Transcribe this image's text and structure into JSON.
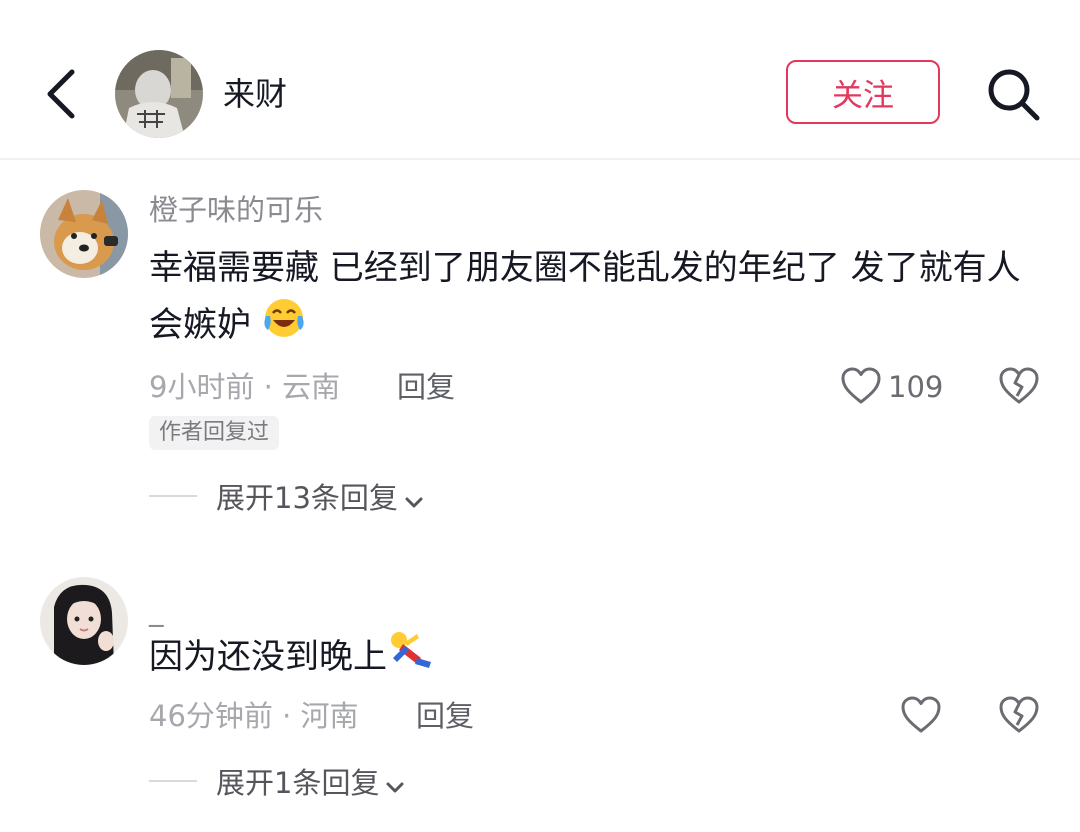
{
  "header": {
    "title": "来财",
    "follow_label": "关注"
  },
  "comments": [
    {
      "username": "橙子味的可乐",
      "text": "幸福需要藏 已经到了朋友圈不能乱发的年纪了 发了就有人会嫉妒",
      "emoji": "crying-laughing-emoji",
      "meta": "9小时前 · 云南",
      "reply_label": "回复",
      "likes": "109",
      "author_badge": "作者回复过",
      "expand_label": "展开13条回复"
    },
    {
      "username": "_",
      "text": "因为还没到晚上",
      "emoji": "lying-down-figure-emoji",
      "meta": "46分钟前 · 河南",
      "reply_label": "回复",
      "likes": "",
      "expand_label": "展开1条回复"
    }
  ],
  "colors": {
    "accent": "#e3375c",
    "text_primary": "#161823",
    "text_secondary": "#8a8b91"
  }
}
